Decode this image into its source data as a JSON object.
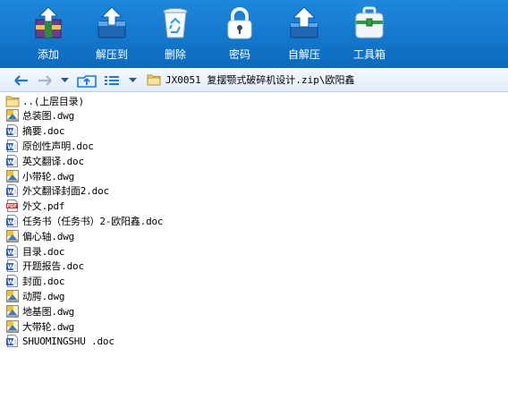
{
  "toolbar": {
    "buttons": [
      {
        "label": "添加",
        "icon": "add-archive-icon"
      },
      {
        "label": "解压到",
        "icon": "extract-to-icon"
      },
      {
        "label": "删除",
        "icon": "delete-recycle-icon"
      },
      {
        "label": "密码",
        "icon": "password-lock-icon"
      },
      {
        "label": "自解压",
        "icon": "self-extract-icon"
      },
      {
        "label": "工具箱",
        "icon": "toolbox-icon"
      }
    ]
  },
  "addressbar": {
    "path": "JX0051 复摆颚式破碎机设计.zip\\欧阳鑫"
  },
  "colors": {
    "toolbar_bg": "#1378cc",
    "addressbar_bg": "#e2edf8",
    "text": "#000000"
  },
  "files": [
    {
      "name": "..(上层目录)",
      "type": "parent-folder"
    },
    {
      "name": "总装图.dwg",
      "type": "dwg"
    },
    {
      "name": "摘要.doc",
      "type": "doc"
    },
    {
      "name": "原创性声明.doc",
      "type": "doc"
    },
    {
      "name": "英文翻译.doc",
      "type": "doc"
    },
    {
      "name": "小带轮.dwg",
      "type": "dwg"
    },
    {
      "name": "外文翻译封面2.doc",
      "type": "doc"
    },
    {
      "name": "外文.pdf",
      "type": "pdf"
    },
    {
      "name": "任务书（任务书）2-欧阳鑫.doc",
      "type": "doc"
    },
    {
      "name": "偏心轴.dwg",
      "type": "dwg"
    },
    {
      "name": "目录.doc",
      "type": "doc"
    },
    {
      "name": "开题报告.doc",
      "type": "doc"
    },
    {
      "name": "封面.doc",
      "type": "doc"
    },
    {
      "name": "动腭.dwg",
      "type": "dwg"
    },
    {
      "name": "地基图.dwg",
      "type": "dwg"
    },
    {
      "name": "大带轮.dwg",
      "type": "dwg"
    },
    {
      "name": "SHUOMINGSHU .doc",
      "type": "doc"
    }
  ]
}
